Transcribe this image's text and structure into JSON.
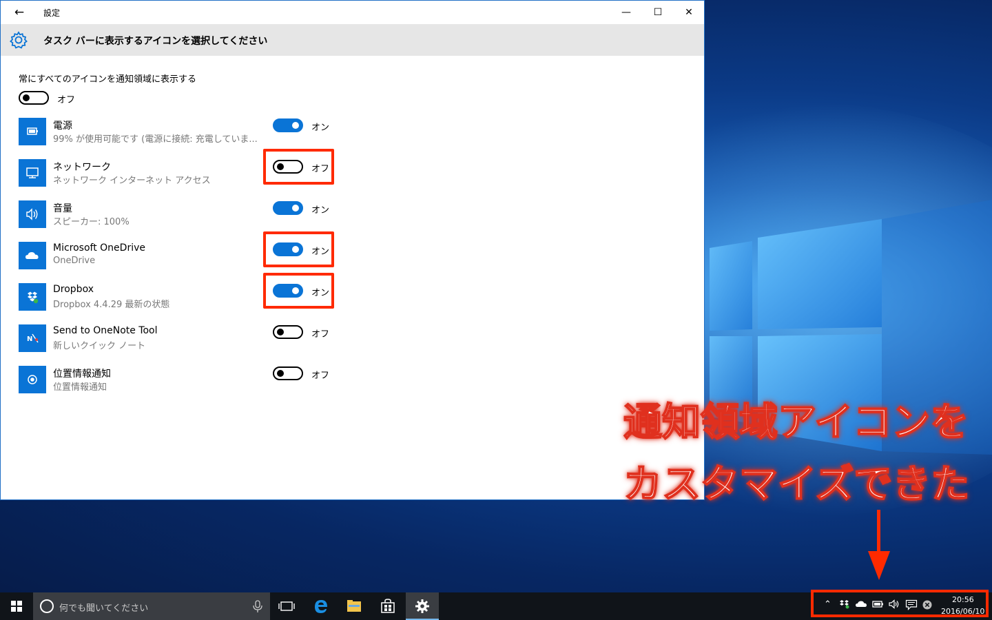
{
  "window": {
    "title": "設定",
    "page_title": "タスク バーに表示するアイコンを選択してください",
    "controls": {
      "minimize": "—",
      "maximize": "☐",
      "close": "✕"
    }
  },
  "always_show": {
    "label": "常にすべてのアイコンを通知領域に表示する",
    "state": "オフ",
    "on": false
  },
  "items": [
    {
      "name": "電源",
      "desc": "99% が使用可能です (電源に接続: 充電していま...",
      "state": "オン",
      "on": true,
      "icon": "battery-icon",
      "glyph": "▭",
      "highlighted": false
    },
    {
      "name": "ネットワーク",
      "desc": "ネットワーク インターネット アクセス",
      "state": "オフ",
      "on": false,
      "icon": "network-icon",
      "glyph": "🖳",
      "highlighted": true
    },
    {
      "name": "音量",
      "desc": "スピーカー: 100%",
      "state": "オン",
      "on": true,
      "icon": "speaker-icon",
      "glyph": "🔊",
      "highlighted": false
    },
    {
      "name": "Microsoft OneDrive",
      "desc": "OneDrive",
      "state": "オン",
      "on": true,
      "icon": "cloud-icon",
      "glyph": "☁",
      "highlighted": true
    },
    {
      "name": "Dropbox",
      "desc": "Dropbox 4.4.29 最新の状態",
      "state": "オン",
      "on": true,
      "icon": "dropbox-icon",
      "glyph": "✦",
      "highlighted": true
    },
    {
      "name": "Send to OneNote Tool",
      "desc": "新しいクイック ノート",
      "state": "オフ",
      "on": false,
      "icon": "onenote-icon",
      "glyph": "N",
      "highlighted": false
    },
    {
      "name": "位置情報通知",
      "desc": "位置情報通知",
      "state": "オフ",
      "on": false,
      "icon": "location-icon",
      "glyph": "◉",
      "highlighted": false
    }
  ],
  "annotation": {
    "line1": "通知領域アイコンを",
    "line2": "カスタマイズできた",
    "color": "#e0301e"
  },
  "taskbar": {
    "search_placeholder": "何でも聞いてください",
    "clock_time": "20:56",
    "clock_date": "2016/06/10"
  },
  "colors": {
    "accent": "#0a74d6",
    "highlight": "#ff2a00",
    "taskbar": "#101419"
  }
}
